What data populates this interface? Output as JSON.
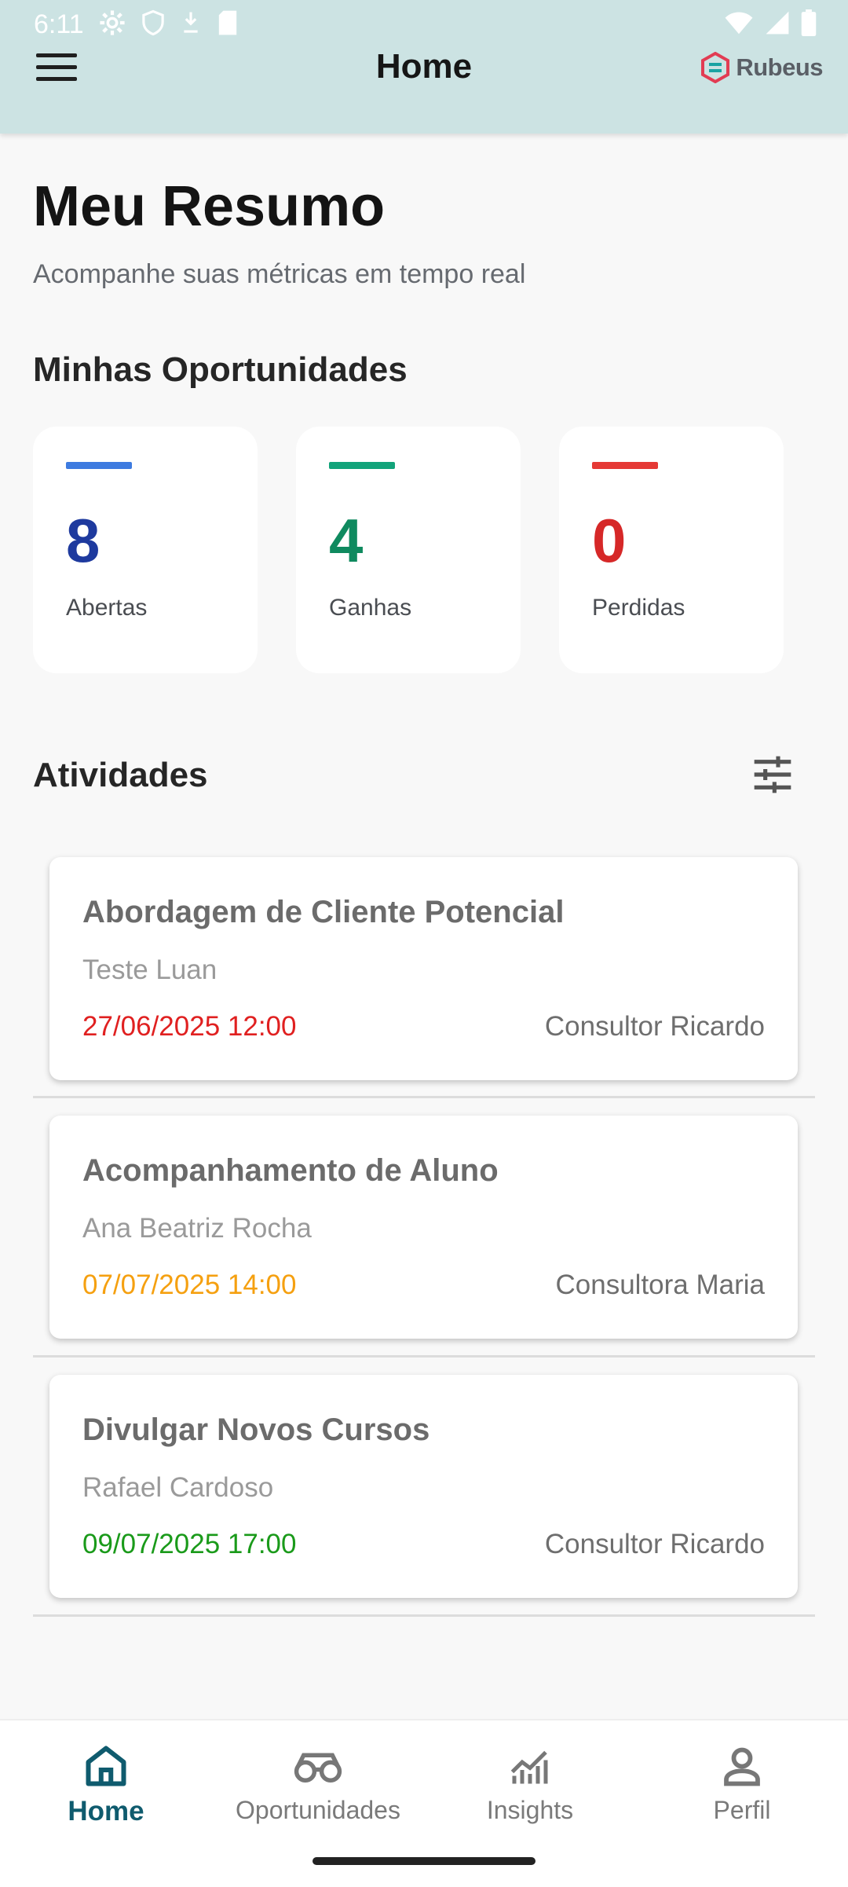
{
  "status_bar": {
    "time": "6:11"
  },
  "app_bar": {
    "title": "Home",
    "brand": "Rubeus"
  },
  "summary": {
    "title": "Meu Resumo",
    "subtitle": "Acompanhe suas métricas em tempo real"
  },
  "opportunities": {
    "title": "Minhas Oportunidades",
    "cards": [
      {
        "value": "8",
        "label": "Abertas",
        "color": "#1e3a9e",
        "bar_color": "#3d7be0"
      },
      {
        "value": "4",
        "label": "Ganhas",
        "color": "#0f8a5f",
        "bar_color": "#12a37a"
      },
      {
        "value": "0",
        "label": "Perdidas",
        "color": "#d62828",
        "bar_color": "#e53935"
      }
    ]
  },
  "activities": {
    "title": "Atividades",
    "items": [
      {
        "title": "Abordagem de Cliente Potencial",
        "person": "Teste Luan",
        "date": "27/06/2025 12:00",
        "date_color": "#e02020",
        "consultant": "Consultor Ricardo"
      },
      {
        "title": "Acompanhamento de Aluno",
        "person": "Ana Beatriz Rocha",
        "date": "07/07/2025 14:00",
        "date_color": "#f5a010",
        "consultant": "Consultora Maria"
      },
      {
        "title": "Divulgar Novos Cursos",
        "person": "Rafael Cardoso",
        "date": "09/07/2025 17:00",
        "date_color": "#1a9a1a",
        "consultant": "Consultor Ricardo"
      }
    ]
  },
  "bottom_nav": {
    "items": [
      {
        "label": "Home",
        "icon": "home-icon",
        "active": true
      },
      {
        "label": "Oportunidades",
        "icon": "binoculars-icon",
        "active": false
      },
      {
        "label": "Insights",
        "icon": "chart-icon",
        "active": false
      },
      {
        "label": "Perfil",
        "icon": "person-icon",
        "active": false
      }
    ]
  },
  "colors": {
    "appbar": "#cce3e3",
    "active_nav": "#0f5b6e"
  }
}
